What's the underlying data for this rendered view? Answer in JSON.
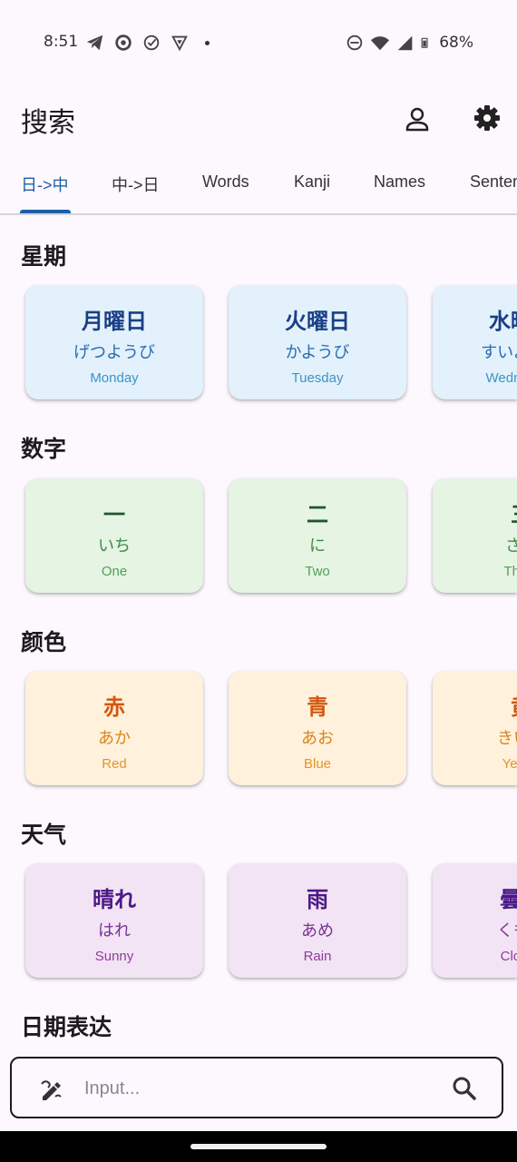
{
  "status_bar": {
    "time": "8:51",
    "battery": "68%",
    "left_icons": [
      "telegram-icon",
      "sync-icon",
      "check-circle-icon",
      "shield-icon"
    ],
    "right_icons": [
      "do-not-disturb-icon",
      "wifi-icon",
      "signal-icon",
      "battery-icon"
    ]
  },
  "app_bar": {
    "title": "搜索",
    "actions": [
      "account-icon",
      "settings-icon"
    ]
  },
  "tabs": [
    {
      "label": "日->中",
      "active": true
    },
    {
      "label": "中->日",
      "active": false
    },
    {
      "label": "Words",
      "active": false
    },
    {
      "label": "Kanji",
      "active": false
    },
    {
      "label": "Names",
      "active": false
    },
    {
      "label": "Sentences",
      "active": false
    }
  ],
  "sections": [
    {
      "title": "星期",
      "color": "#e2f1fb",
      "cards": [
        {
          "word": "月曜日",
          "reading": "げつようび",
          "meaning": "Monday"
        },
        {
          "word": "火曜日",
          "reading": "かようび",
          "meaning": "Tuesday"
        },
        {
          "word": "水曜日",
          "reading": "すいようび",
          "meaning": "Wednesday"
        }
      ]
    },
    {
      "title": "数字",
      "color": "#e6f4e4",
      "cards": [
        {
          "word": "一",
          "reading": "いち",
          "meaning": "One"
        },
        {
          "word": "二",
          "reading": "に",
          "meaning": "Two"
        },
        {
          "word": "三",
          "reading": "さん",
          "meaning": "Three"
        }
      ]
    },
    {
      "title": "颜色",
      "color": "#fff1dc",
      "cards": [
        {
          "word": "赤",
          "reading": "あか",
          "meaning": "Red"
        },
        {
          "word": "青",
          "reading": "あお",
          "meaning": "Blue"
        },
        {
          "word": "黄",
          "reading": "きいろ",
          "meaning": "Yellow"
        }
      ]
    },
    {
      "title": "天气",
      "color": "#f2e4f4",
      "cards": [
        {
          "word": "晴れ",
          "reading": "はれ",
          "meaning": "Sunny"
        },
        {
          "word": "雨",
          "reading": "あめ",
          "meaning": "Rain"
        },
        {
          "word": "曇り",
          "reading": "くもり",
          "meaning": "Cloudy"
        }
      ]
    },
    {
      "title": "日期表达",
      "cards": []
    }
  ],
  "search": {
    "placeholder": "Input...",
    "value": ""
  }
}
